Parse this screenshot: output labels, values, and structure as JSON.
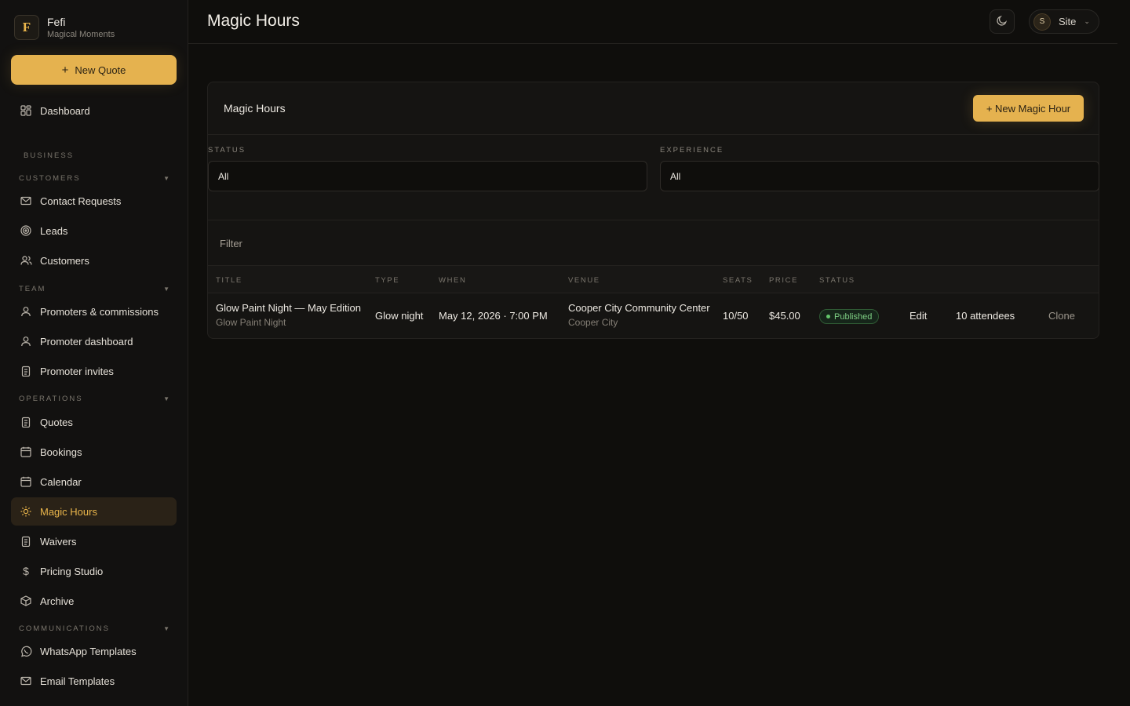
{
  "brand": {
    "initial": "F",
    "name": "Fefi",
    "subtitle": "Magical Moments"
  },
  "sidebar": {
    "new_quote_label": "New Quote",
    "dashboard": "Dashboard",
    "section_business": "BUSINESS",
    "group_customers": "CUSTOMERS",
    "contact_requests": "Contact Requests",
    "leads": "Leads",
    "customers": "Customers",
    "group_team": "TEAM",
    "promoters_commissions": "Promoters & commissions",
    "promoter_dashboard": "Promoter dashboard",
    "promoter_invites": "Promoter invites",
    "group_operations": "OPERATIONS",
    "quotes": "Quotes",
    "bookings": "Bookings",
    "calendar": "Calendar",
    "magic_hours": "Magic Hours",
    "waivers": "Waivers",
    "pricing_studio": "Pricing Studio",
    "archive": "Archive",
    "group_communications": "COMMUNICATIONS",
    "whatsapp_templates": "WhatsApp Templates",
    "email_templates": "Email Templates"
  },
  "header": {
    "title": "Magic Hours",
    "avatar_initial": "S",
    "site_label": "Site"
  },
  "card": {
    "title": "Magic Hours",
    "new_button": "+ New Magic Hour",
    "status_label": "STATUS",
    "status_value": "All",
    "experience_label": "EXPERIENCE",
    "experience_value": "All",
    "filter_label": "Filter"
  },
  "table": {
    "columns": [
      "TITLE",
      "TYPE",
      "WHEN",
      "VENUE",
      "SEATS",
      "PRICE",
      "STATUS"
    ],
    "rows": [
      {
        "title": "Glow Paint Night — May Edition",
        "title_sub": "Glow Paint Night",
        "type": "Glow night",
        "when": "May 12, 2026 · 7:00 PM",
        "venue": "Cooper City Community Center",
        "venue_sub": "Cooper City",
        "seats": "10/50",
        "price": "$45.00",
        "status": "Published",
        "edit": "Edit",
        "attendees": "10 attendees",
        "clone": "Clone"
      }
    ]
  },
  "colors": {
    "accent": "#e5b24f",
    "published": "#63c66b",
    "background": "#0f0e0c"
  }
}
